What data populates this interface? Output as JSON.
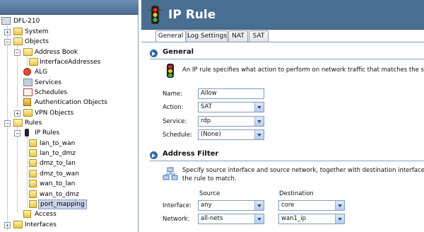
{
  "tree": {
    "root": "DFL-210",
    "items": [
      {
        "label": "System",
        "exp": "+"
      },
      {
        "label": "Objects",
        "exp": "−"
      },
      {
        "label": "Address Book",
        "exp": "−"
      },
      {
        "label": "InterfaceAddresses"
      },
      {
        "label": "ALG"
      },
      {
        "label": "Services"
      },
      {
        "label": "Schedules"
      },
      {
        "label": "Authentication Objects"
      },
      {
        "label": "VPN Objects",
        "exp": "+"
      },
      {
        "label": "Rules",
        "exp": "−"
      },
      {
        "label": "IP Rules",
        "exp": "−"
      },
      {
        "label": "lan_to_wan"
      },
      {
        "label": "lan_to_dmz"
      },
      {
        "label": "dmz_to_lan"
      },
      {
        "label": "dmz_to_wan"
      },
      {
        "label": "wan_to_lan"
      },
      {
        "label": "wan_to_dmz"
      },
      {
        "label": "port_mapping"
      },
      {
        "label": "Access"
      },
      {
        "label": "Interfaces",
        "exp": "+"
      }
    ]
  },
  "header": {
    "title": "IP Rule"
  },
  "tabs": [
    {
      "label": "General",
      "active": true
    },
    {
      "label": "Log Settings"
    },
    {
      "label": "NAT"
    },
    {
      "label": "SAT"
    }
  ],
  "general": {
    "title": "General",
    "description": "An IP rule specifies what action to perform on network traffic that matches the specified filte",
    "name_label": "Name:",
    "name_value": "Allow",
    "action_label": "Action:",
    "action_value": "SAT",
    "service_label": "Service:",
    "service_value": "rdp",
    "schedule_label": "Schedule:",
    "schedule_value": "(None)"
  },
  "address_filter": {
    "title": "Address Filter",
    "description_line1": "Specify source interface and source network, together with destination interface and destina",
    "description_line2": "the rule to match.",
    "source_header": "Source",
    "destination_header": "Destination",
    "interface_label": "Interface:",
    "source_interface": "any",
    "destination_interface": "core",
    "network_label": "Network:",
    "source_network": "all-nets",
    "destination_network": "wan1_ip"
  }
}
